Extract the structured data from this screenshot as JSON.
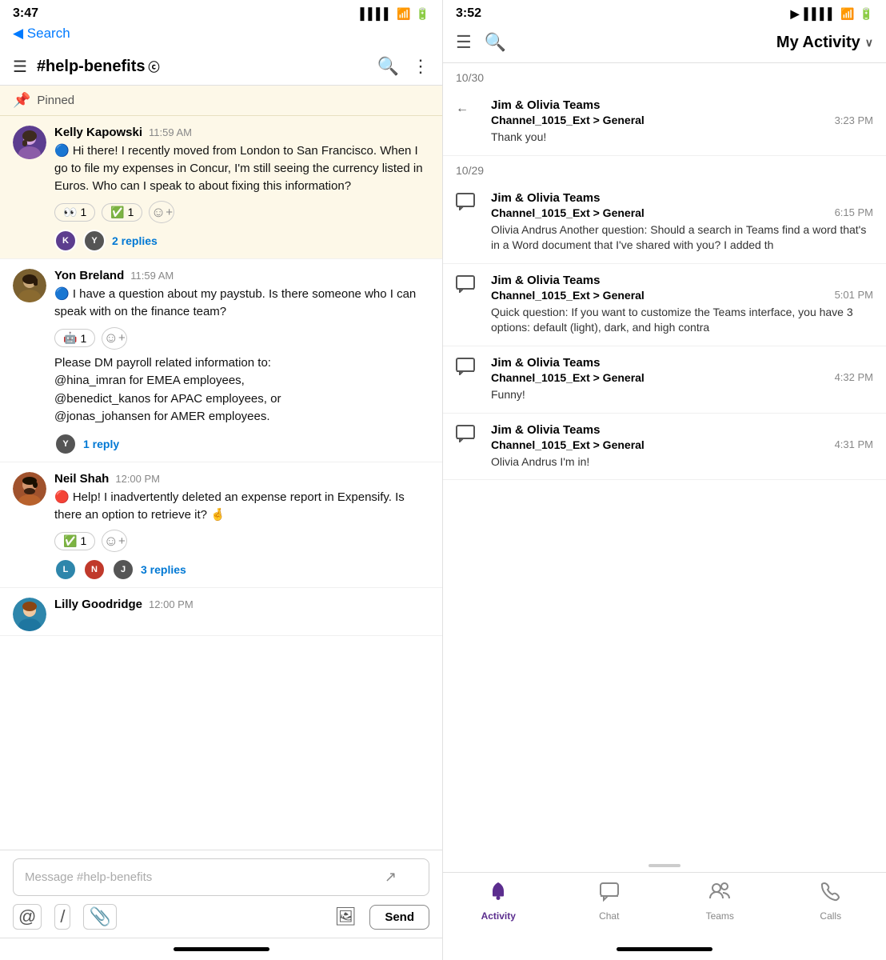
{
  "left": {
    "statusBar": {
      "time": "3:47",
      "locationIcon": "▶",
      "backLabel": "◀ Search"
    },
    "channel": {
      "title": "#help-benefits",
      "coIcon": "ⓒ"
    },
    "pinned": {
      "label": "Pinned"
    },
    "messages": [
      {
        "id": "msg1",
        "author": "Kelly Kapowski",
        "time": "11:59 AM",
        "text": "🔵 Hi there! I recently moved from London to San Francisco. When I go to file my expenses in Concur, I'm still seeing the currency listed in Euros. Who can I speak to about fixing this information?",
        "reactions": [
          {
            "emoji": "👀",
            "count": "1"
          },
          {
            "emoji": "✅",
            "count": "1"
          }
        ],
        "replies": 2,
        "replyAvatars": [
          "kelly",
          "dark"
        ],
        "avatarColor": "#5c3d8f",
        "avatarInitial": "K",
        "isPinned": true
      },
      {
        "id": "msg2",
        "author": "Yon Breland",
        "time": "11:59 AM",
        "text": "🔵 I have a question about my paystub. Is there someone who I can speak with on the finance team?",
        "reactions": [
          {
            "emoji": "🤖",
            "count": "1"
          }
        ],
        "payrollText": "Please DM payroll related information to:\n@hina_imran for EMEA employees,\n@benedict_kanos for APAC employees, or\n@jonas_johansen for AMER employees.",
        "replies": 1,
        "replyAvatars": [
          "yon"
        ],
        "avatarColor": "#8b6914",
        "avatarInitial": "Y",
        "isPinned": false
      },
      {
        "id": "msg3",
        "author": "Neil Shah",
        "time": "12:00 PM",
        "text": "🔴 Help! I inadvertently deleted an expense report in Expensify. Is there an option to retrieve it? 🤞",
        "reactions": [
          {
            "emoji": "✅",
            "count": "1"
          }
        ],
        "replies": 3,
        "replyAvatars": [
          "lilly",
          "neil",
          "dark"
        ],
        "avatarColor": "#c0392b",
        "avatarInitial": "N",
        "isPinned": false
      },
      {
        "id": "msg4",
        "author": "Lilly Goodridge",
        "time": "12:00 PM",
        "text": "",
        "avatarColor": "#2e86ab",
        "avatarInitial": "L",
        "isPinned": false,
        "truncated": true
      }
    ],
    "inputPlaceholder": "Message #help-benefits",
    "sendLabel": "Send"
  },
  "right": {
    "statusBar": {
      "time": "3:52",
      "locationIcon": "▶"
    },
    "header": {
      "title": "My Activity",
      "chevron": "∨"
    },
    "sections": [
      {
        "date": "10/30",
        "items": [
          {
            "type": "reply",
            "sender": "Jim & Olivia Teams",
            "channel": "Channel_1015_Ext > General",
            "time": "3:23 PM",
            "preview": "Thank you!"
          }
        ]
      },
      {
        "date": "10/29",
        "items": [
          {
            "type": "message",
            "sender": "Jim & Olivia Teams",
            "channel": "Channel_1015_Ext > General",
            "time": "6:15 PM",
            "preview": "Olivia Andrus Another question: Should a search in Teams find a word that's in a Word document that I've shared with you? I added th"
          },
          {
            "type": "message",
            "sender": "Jim & Olivia Teams",
            "channel": "Channel_1015_Ext > General",
            "time": "5:01 PM",
            "preview": "Quick question: If you want to customize the Teams interface, you have 3 options: default (light), dark, and high contra"
          },
          {
            "type": "message",
            "sender": "Jim & Olivia Teams",
            "channel": "Channel_1015_Ext > General",
            "time": "4:32 PM",
            "preview": "Funny!"
          },
          {
            "type": "message",
            "sender": "Jim & Olivia Teams",
            "channel": "Channel_1015_Ext > General",
            "time": "4:31 PM",
            "preview": "Olivia Andrus I'm in!"
          }
        ]
      }
    ],
    "bottomNav": [
      {
        "id": "activity",
        "label": "Activity",
        "icon": "🔔",
        "active": true
      },
      {
        "id": "chat",
        "label": "Chat",
        "icon": "💬",
        "active": false
      },
      {
        "id": "teams",
        "label": "Teams",
        "icon": "👥",
        "active": false
      },
      {
        "id": "calls",
        "label": "Calls",
        "icon": "📞",
        "active": false
      }
    ]
  }
}
